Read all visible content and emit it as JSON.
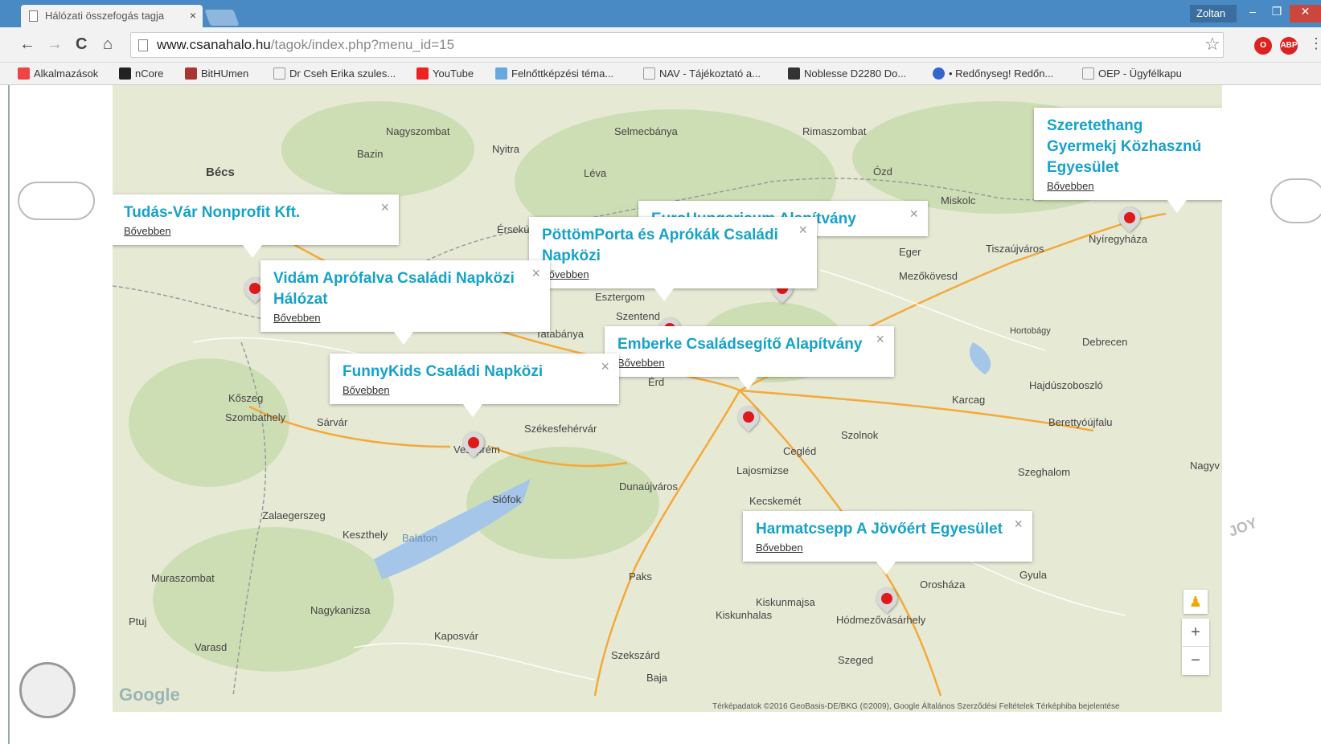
{
  "browser": {
    "tab_title": "Hálózati összefogás tagja",
    "tab_close": "×",
    "user_label": "Zoltan",
    "url_host": "www.csanahalo.hu",
    "url_path": "/tagok/index.php?menu_id=15",
    "nav": {
      "back": "←",
      "forward": "→",
      "reload": "C",
      "home": "⌂"
    },
    "win": {
      "min": "–",
      "max": "❐",
      "close": "✕"
    },
    "bookmarks": [
      {
        "label": "Alkalmazások",
        "color": "#e44"
      },
      {
        "label": "nCore",
        "color": "#222"
      },
      {
        "label": "BitHUmen",
        "color": "#a33"
      },
      {
        "label": "Dr Cseh Erika szules...",
        "color": "#aaa"
      },
      {
        "label": "YouTube",
        "color": "#e22"
      },
      {
        "label": "Felnőttképzési téma...",
        "color": "#6ad"
      },
      {
        "label": "NAV - Tájékoztató a...",
        "color": "#aaa"
      },
      {
        "label": "Noblesse D2280 Do...",
        "color": "#333"
      },
      {
        "label": "• Redőnyseg! Redőn...",
        "color": "#36c"
      },
      {
        "label": "OEP - Ügyfélkapu",
        "color": "#aaa"
      }
    ]
  },
  "map": {
    "places": [
      "Nagyszombat",
      "Selmecbánya",
      "Rimaszombat",
      "Bécs",
      "Bazin",
      "Nyitra",
      "Léva",
      "Ózd",
      "Miskolc",
      "Érsekú",
      "Eger",
      "Nyíregyháza",
      "Tiszaújváros",
      "Mezőkövesd",
      "Szentend",
      "Esztergom",
      "Tatabánya",
      "Kőszeg",
      "Szombathely",
      "Sárvár",
      "Székesfehérvár",
      "Veszprém",
      "Debrecen",
      "Hajdúszoboszló",
      "Karcag",
      "Szolnok",
      "Cegléd",
      "Berettyóújfalu",
      "Dunaújváros",
      "Kecskemét",
      "Siófok",
      "Keszthely",
      "Zalaegerszeg",
      "Kiskunhalas",
      "Kiskunmajsa",
      "Hódmezővásárhely",
      "Orosháza",
      "Gyula",
      "Szeged",
      "Paks",
      "Kaposvár",
      "Nagykanizsa",
      "Szekszárd",
      "Baja",
      "Szeghalom",
      "Nagyv",
      "Ptuj",
      "Varasd",
      "Muraszombat",
      "Lajosmizse",
      "Balaton",
      "Érd",
      "Hortobágy"
    ],
    "info_windows": [
      {
        "title": "Tudás-Vár Nonprofit Kft.",
        "link": "Bővebben"
      },
      {
        "title": "Vidám Aprófalva Családi Napközi Hálózat",
        "link": "Bővebben"
      },
      {
        "title": "FunnyKids Családi Napközi",
        "link": "Bővebben"
      },
      {
        "title": "EuroHungaricum Alapítvány",
        "link": ""
      },
      {
        "title": "PöttömPorta és Aprókák Családi Napközi",
        "link": "Bővebben"
      },
      {
        "title": "Emberke Családsegítő Alapítvány",
        "link": "Bővebben"
      },
      {
        "title": "Szeretethang Gyermekj Közhasznú Egyesület",
        "link": "Bővebben"
      },
      {
        "title": "Harmatcsepp A Jövőért Egyesület",
        "link": "Bővebben"
      }
    ],
    "close_symbol": "×",
    "zoom_in": "+",
    "zoom_out": "−",
    "logo": "Google",
    "terms": "Térképadatok ©2016 GeoBasis-DE/BKG (©2009), Google   Általános Szerződési Feltételek   Térképhiba bejelentése"
  },
  "decor": {
    "joy": "JOY"
  }
}
